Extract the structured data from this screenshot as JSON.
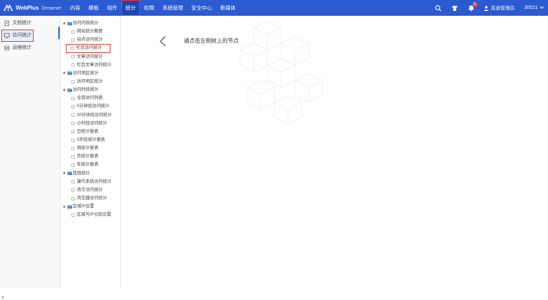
{
  "header": {
    "logo_text": "WebPlus",
    "logo_sub": "Dreamer",
    "nav": [
      {
        "label": "内容"
      },
      {
        "label": "模板"
      },
      {
        "label": "组件"
      },
      {
        "label": "统计"
      },
      {
        "label": "权限"
      },
      {
        "label": "系统管理"
      },
      {
        "label": "安全中心"
      },
      {
        "label": "新媒体"
      }
    ],
    "active_nav": "统计",
    "notification_count": "1",
    "user_name": "苏迪管理员",
    "site_code": "30021",
    "icons": [
      "search-icon",
      "shirt-icon",
      "bell-icon",
      "user-icon",
      "chevron-down-icon"
    ]
  },
  "sidebar": {
    "items": [
      {
        "label": "文档统计",
        "icon": "document-icon"
      },
      {
        "label": "访问统计",
        "icon": "monitor-icon"
      },
      {
        "label": "运维统计",
        "icon": "server-icon"
      }
    ],
    "active": "访问统计"
  },
  "tree": {
    "groups": [
      {
        "label": "访问内容统计",
        "children": [
          "网站统计概要",
          "站点访问统计",
          "栏目访问统计",
          "文章访问统计",
          "栏目文章访问统计"
        ]
      },
      {
        "label": "访问地区统计",
        "children": [
          "访问地区统计"
        ]
      },
      {
        "label": "访问时段统计",
        "children": [
          "全部访问列表",
          "5分钟段访问统计",
          "30分钟段访问统计",
          "小时段访问统计",
          "日统计报表",
          "3天段统计报表",
          "周统计报表",
          "月统计报表",
          "年统计报表"
        ]
      },
      {
        "label": "其他统计",
        "children": [
          "操作系统访问统计",
          "语言访问统计",
          "浏览器访问统计"
        ]
      },
      {
        "label": "区域IP设置",
        "children": [
          "区域与IP分段设置"
        ]
      }
    ],
    "highlighted_leaf": "栏目访问统计"
  },
  "main": {
    "hint": "请点击左侧树上的节点"
  },
  "corner_tip": "元...",
  "colors": {
    "header_bg": "#2b5ad1",
    "highlight_border": "#e53935",
    "sidebar_bg": "#f7f8fa"
  }
}
